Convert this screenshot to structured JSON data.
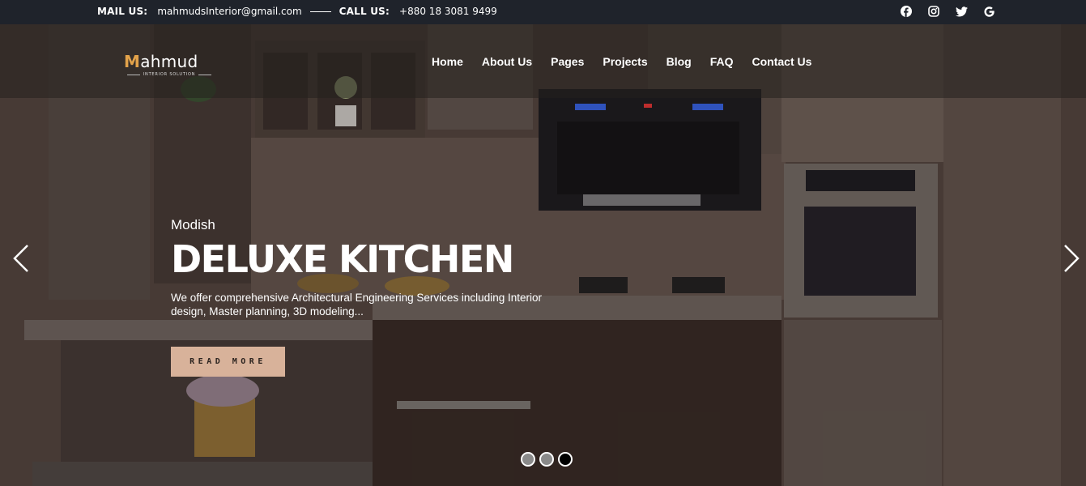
{
  "topbar": {
    "mail_label": "MAIL US:",
    "mail_value": "mahmudsInterior@gmail.com",
    "call_label": "CALL US:",
    "call_value": "+880 18 3081 9499",
    "social_icons": [
      "facebook-icon",
      "instagram-icon",
      "twitter-icon",
      "google-icon"
    ]
  },
  "logo": {
    "initial": "M",
    "rest": "ahmud",
    "tagline": "INTERIOR SOLUTION"
  },
  "nav": [
    "Home",
    "About Us",
    "Pages",
    "Projects",
    "Blog",
    "FAQ",
    "Contact Us"
  ],
  "slide": {
    "eyebrow": "Modish",
    "headline": "DELUXE KITCHEN",
    "description": "We offer comprehensive Architectural Engineering Services including Interior design, Master planning, 3D modeling...",
    "button": "READ MORE"
  },
  "carousel": {
    "slides": 3,
    "active_index": 3
  },
  "colors": {
    "topbar_bg": "#1f232b",
    "button_bg": "#d8b29a",
    "logo_accent": "#e2a24a"
  }
}
